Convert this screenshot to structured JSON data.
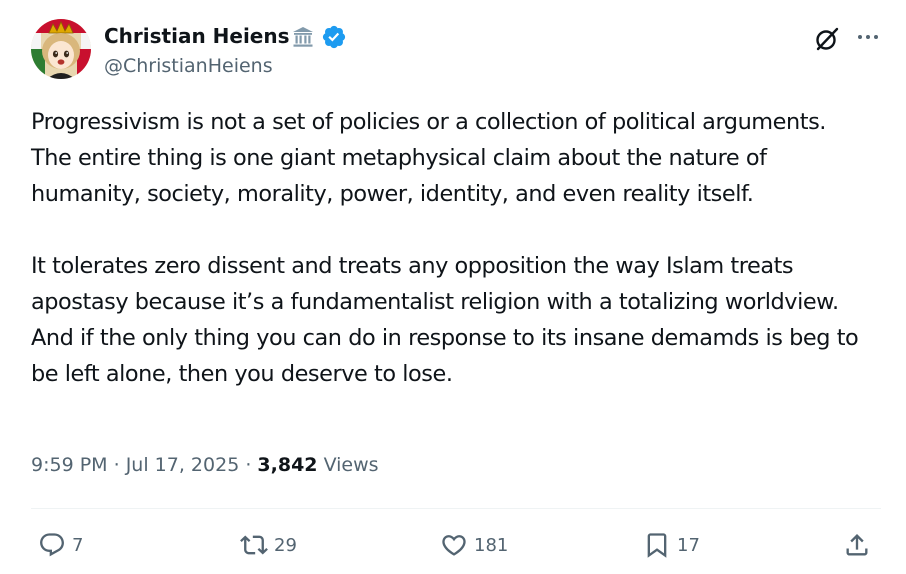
{
  "author": {
    "display_name": "Christian Heiens",
    "handle": "@ChristianHeiens",
    "badges": [
      "government-building-icon",
      "verified-badge-icon"
    ],
    "verified_color": "#1d9bf0"
  },
  "header_actions": [
    "grok-icon",
    "more-icon"
  ],
  "post": {
    "paragraphs": [
      "Progressivism is not a set of policies or a collection of political arguments. The entire thing is one giant metaphysical claim about the nature of humanity, society, morality, power, identity, and even reality itself.",
      "It tolerates zero dissent and treats any opposition the way Islam treats apostasy because it’s a fundamentalist religion with a totalizing worldview. And if the only thing you can do in response to its insane demamds is beg to be left alone, then you deserve to lose."
    ]
  },
  "meta": {
    "time": "9:59 PM",
    "separator": "·",
    "date": "Jul 17, 2025",
    "views_count": "3,842",
    "views_label": "Views"
  },
  "actions": {
    "reply": {
      "icon": "reply-icon",
      "count": "7"
    },
    "retweet": {
      "icon": "retweet-icon",
      "count": "29"
    },
    "like": {
      "icon": "heart-icon",
      "count": "181"
    },
    "bookmark": {
      "icon": "bookmark-icon",
      "count": "17"
    },
    "share": {
      "icon": "share-icon"
    }
  },
  "colors": {
    "text_primary": "#0f1419",
    "text_secondary": "#536471",
    "divider": "#eff3f4",
    "accent": "#1d9bf0"
  }
}
